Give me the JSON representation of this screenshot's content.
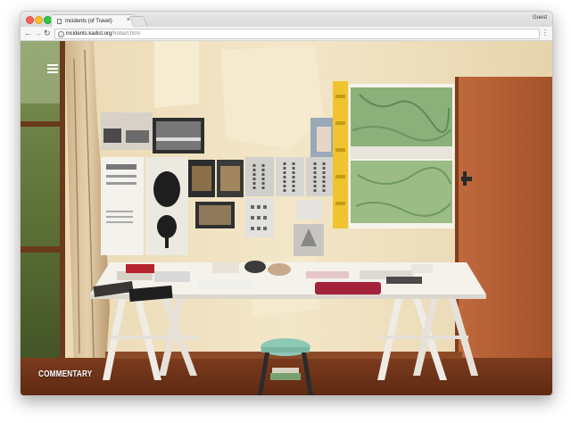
{
  "window": {
    "tab_title": "Incidents (of Travel)",
    "profile_label": "Guest"
  },
  "toolbar": {
    "url_host": "incidents.kadist.org",
    "url_path": "/hobart.html"
  },
  "icons": {
    "back": "back-arrow-icon",
    "forward": "forward-arrow-icon",
    "reload": "reload-icon",
    "info": "info-icon",
    "menu": "hamburger-menu-icon",
    "kebab": "kebab-menu-icon"
  },
  "page": {
    "commentary_label": "COMMENTARY"
  },
  "colors": {
    "wall": "#efe1bf",
    "door": "#b8623a",
    "floor": "#7a3a1e",
    "table": "#f3f0ea"
  }
}
